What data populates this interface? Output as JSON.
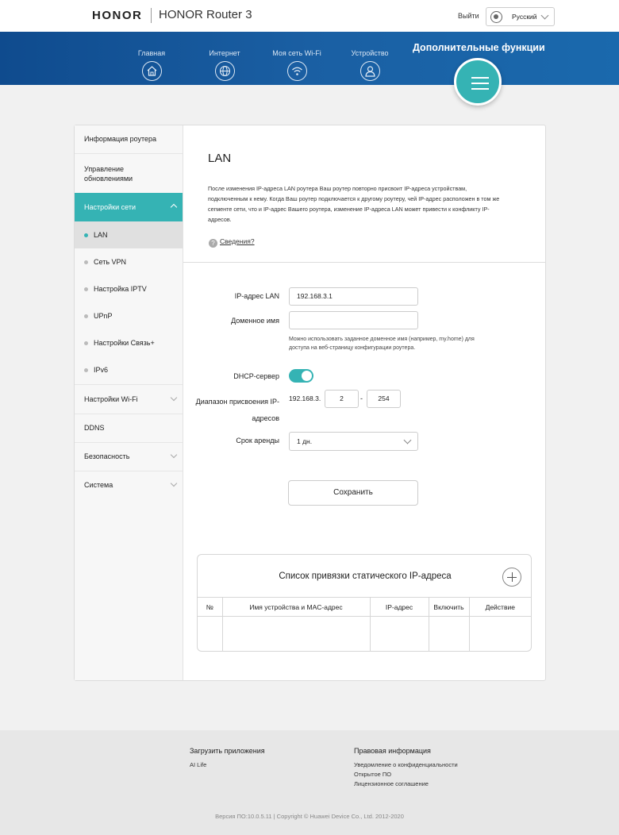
{
  "header": {
    "brand": "HONOR",
    "product": "HONOR Router 3",
    "logout": "Выйти",
    "language": "Русский"
  },
  "nav": {
    "items": [
      {
        "label": "Главная",
        "icon": "home-icon"
      },
      {
        "label": "Интернет",
        "icon": "globe-icon"
      },
      {
        "label": "Моя сеть Wi-Fi",
        "icon": "wifi-icon"
      },
      {
        "label": "Устройство",
        "icon": "user-icon"
      }
    ],
    "extra": "Дополнительные функции",
    "accent": "#35b3b4"
  },
  "sidebar": {
    "items": [
      {
        "label": "Информация роутера"
      },
      {
        "label": "Управление\nобновлениями"
      },
      {
        "label": "Настройки сети",
        "active": true
      },
      {
        "label": "LAN",
        "selected": true
      },
      {
        "label": "Сеть VPN"
      },
      {
        "label": "Настройка IPTV"
      },
      {
        "label": "UPnP"
      },
      {
        "label": "Настройки Связь+"
      },
      {
        "label": "IPv6"
      },
      {
        "label": "Настройки Wi-Fi"
      },
      {
        "label": "DDNS"
      },
      {
        "label": "Безопасность"
      },
      {
        "label": "Система"
      }
    ]
  },
  "main": {
    "title": "LAN",
    "description": "После изменения IP-адреса LAN роутера Ваш роутер повторно присвоит IP-адреса устройствам, подключенным к нему. Когда Ваш роутер подключается к другому роутеру, чей IP-адрес расположен в том же сегменте сети, что и IP-адрес Вашего роутера, изменение IP-адреса LAN может привести к конфликту IP-адресов.",
    "help_link": "Сведения?",
    "help_icon": "?",
    "form": {
      "lan_ip_label": "IP-адрес LAN",
      "lan_ip_value": "192.168.3.1",
      "domain_label": "Доменное имя",
      "domain_value": "",
      "domain_hint": "Можно использовать заданное доменное имя (например, my.home) для доступа на веб-страницу конфигурации роутера.",
      "dhcp_label": "DHCP-сервер",
      "dhcp_enabled": true,
      "range_label": "Диапазон присвоения IP-адресов",
      "range_prefix": "192.168.3.",
      "range_start": "2",
      "range_separator": "-",
      "range_end": "254",
      "lease_label": "Срок аренды",
      "lease_value": "1 дн.",
      "save_label": "Сохранить"
    },
    "static_table": {
      "title": "Список привязки статического IP-адреса",
      "columns": [
        "№",
        "Имя устройства и MAC-адрес",
        "IP-адрес",
        "Включить",
        "Действие"
      ],
      "rows": []
    }
  },
  "footer": {
    "apps_title": "Загрузить приложения",
    "apps_link": "AI Life",
    "legal_title": "Правовая информация",
    "legal_links": [
      "Уведомление о конфиденциальности",
      "Открытое ПО",
      "Лицензионное соглашение"
    ],
    "copyright": "Версия ПО:10.0.5.11 | Copyright © Huawei Device Co., Ltd. 2012-2020"
  }
}
